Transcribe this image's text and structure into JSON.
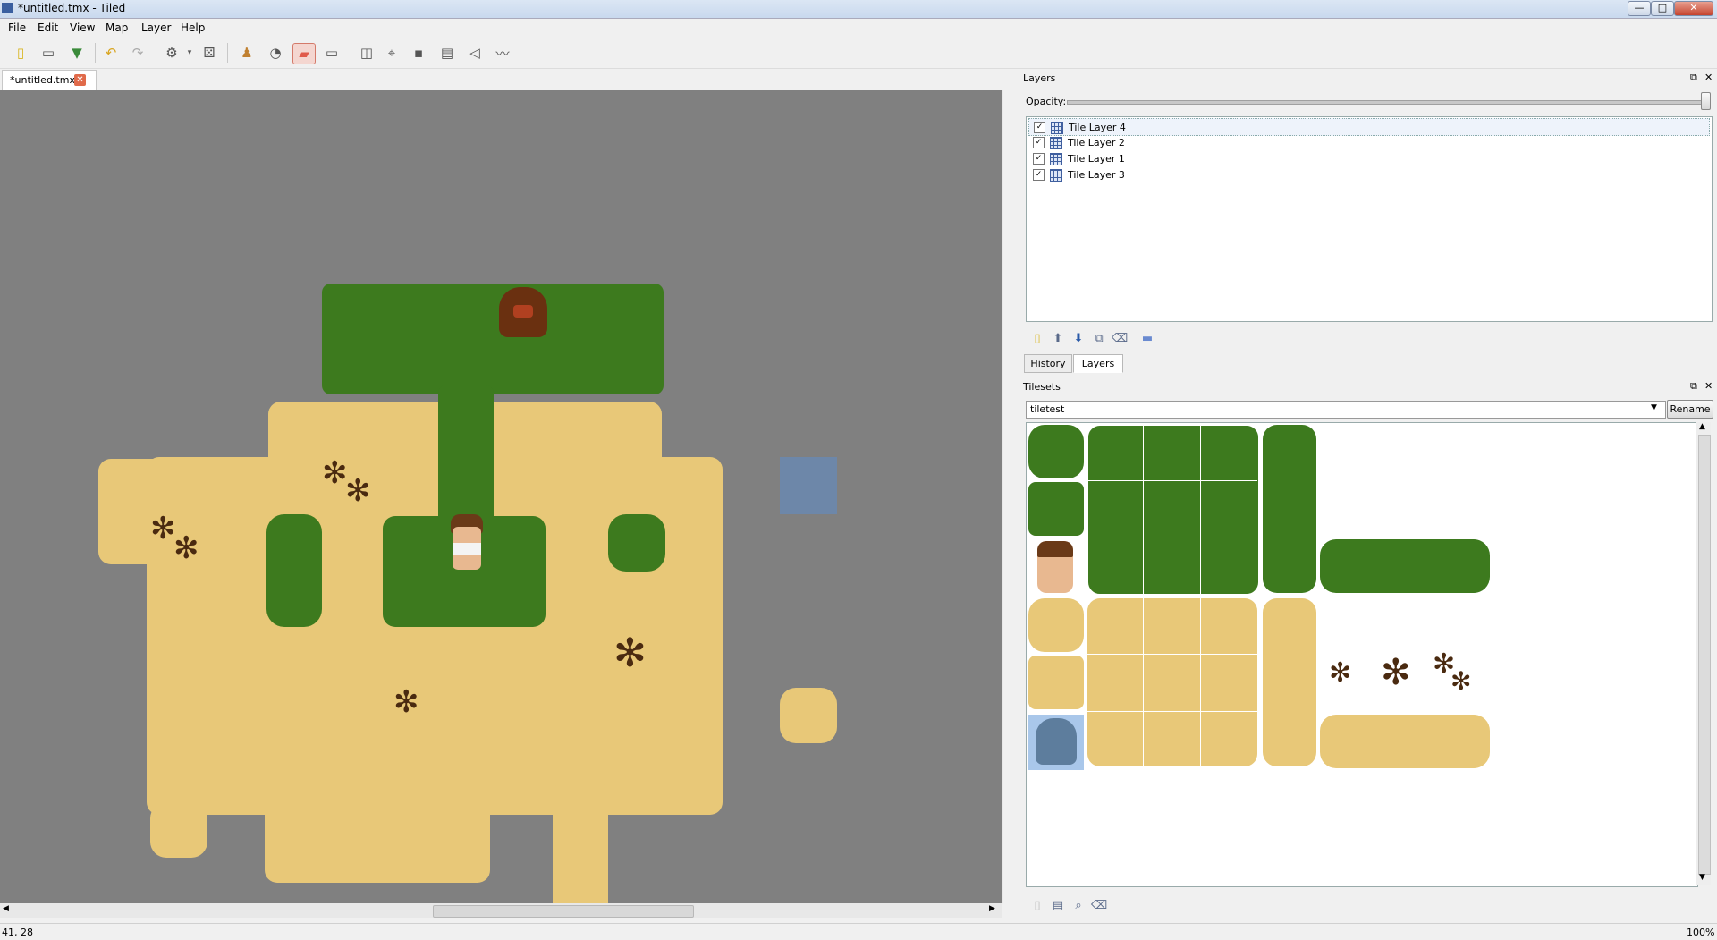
{
  "window": {
    "title": "*untitled.tmx - Tiled",
    "minimize": "—",
    "maximize": "□",
    "close": "✕"
  },
  "menu": [
    "File",
    "Edit",
    "View",
    "Map",
    "Layer",
    "Help"
  ],
  "toolbar": {
    "icons": [
      "new-file",
      "open-file",
      "save-file",
      "undo",
      "redo",
      "commands",
      "random-mode",
      "stamp-brush",
      "bucket-fill",
      "eraser",
      "rectangle-select",
      "insert-object",
      "edit-polygons",
      "insert-tile",
      "insert-image",
      "insert-polygon",
      "insert-polyline"
    ],
    "active": "eraser"
  },
  "document_tab": {
    "label": "*untitled.tmx",
    "close": "✕"
  },
  "layers_panel": {
    "title": "Layers",
    "opacity_label": "Opacity:",
    "opacity": 1.0,
    "layers": [
      {
        "name": "Tile Layer 4",
        "visible": true,
        "selected": true
      },
      {
        "name": "Tile Layer 2",
        "visible": true,
        "selected": false
      },
      {
        "name": "Tile Layer 1",
        "visible": true,
        "selected": false
      },
      {
        "name": "Tile Layer 3",
        "visible": true,
        "selected": false
      }
    ],
    "check": "✓",
    "buttons": [
      "add-layer",
      "raise-layer",
      "lower-layer",
      "duplicate-layer",
      "remove-layer",
      "toggle-other-layers"
    ]
  },
  "bottom_tabs": {
    "history": "History",
    "layers": "Layers",
    "active": "Layers"
  },
  "tilesets_panel": {
    "title": "Tilesets",
    "selected_tileset": "tiletest",
    "rename_label": "Rename",
    "buttons": [
      "new-tileset",
      "import-tileset",
      "export-tileset",
      "remove-tileset"
    ]
  },
  "status": {
    "coords": "41, 28",
    "zoom": "100%"
  },
  "colors": {
    "grass": "#3d7a1e",
    "sand": "#e8c878",
    "canvas": "#808080",
    "selection": "#6a88b0"
  }
}
